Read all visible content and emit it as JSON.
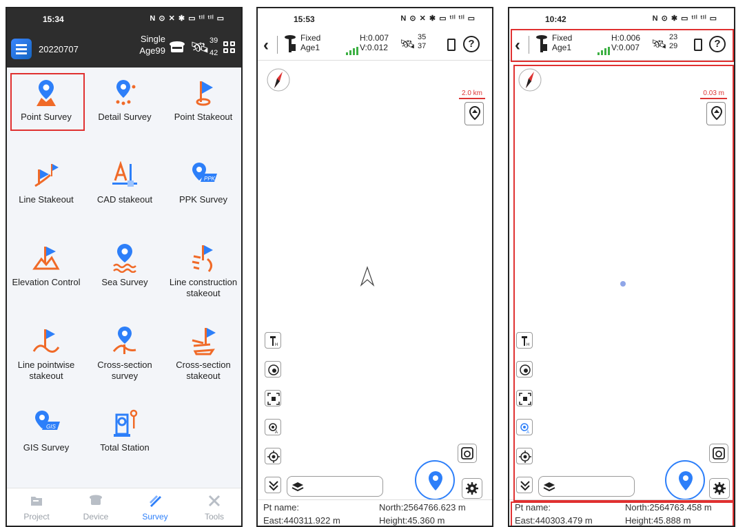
{
  "screen1": {
    "status": {
      "time": "15:34",
      "icons": "N ⊙ ✕ ✱ ▭ ᵗᴵˡ ᵗᴵˡ ▭"
    },
    "header": {
      "project": "20220707",
      "solution": "Single",
      "age": "Age99",
      "sat_top": "39",
      "sat_bottom": "42"
    },
    "menu": [
      {
        "label": "Point Survey",
        "icon": "point-survey-icon"
      },
      {
        "label": "Detail Survey",
        "icon": "detail-survey-icon"
      },
      {
        "label": "Point Stakeout",
        "icon": "point-stakeout-icon"
      },
      {
        "label": "Line Stakeout",
        "icon": "line-stakeout-icon"
      },
      {
        "label": "CAD stakeout",
        "icon": "cad-stakeout-icon"
      },
      {
        "label": "PPK Survey",
        "icon": "ppk-survey-icon"
      },
      {
        "label": "Elevation Control",
        "icon": "elevation-control-icon"
      },
      {
        "label": "Sea Survey",
        "icon": "sea-survey-icon"
      },
      {
        "label": "Line construction stakeout",
        "icon": "line-construction-stakeout-icon"
      },
      {
        "label": "Line pointwise stakeout",
        "icon": "line-pointwise-stakeout-icon"
      },
      {
        "label": "Cross-section survey",
        "icon": "cross-section-survey-icon"
      },
      {
        "label": "Cross-section stakeout",
        "icon": "cross-section-stakeout-icon"
      },
      {
        "label": "GIS Survey",
        "icon": "gis-survey-icon"
      },
      {
        "label": "Total Station",
        "icon": "total-station-icon"
      }
    ],
    "ppk_tag": "PPK",
    "gis_tag": "GIS",
    "tabs": [
      {
        "label": "Project",
        "active": false
      },
      {
        "label": "Device",
        "active": false
      },
      {
        "label": "Survey",
        "active": true
      },
      {
        "label": "Tools",
        "active": false
      }
    ]
  },
  "screen2": {
    "status": {
      "time": "15:53",
      "icons": "N ⊙ ✕ ✱ ▭ ᵗᴵˡ ᵗᴵˡ ▭"
    },
    "header": {
      "solution": "Fixed",
      "age": "Age1",
      "h": "H:0.007",
      "v": "V:0.012",
      "sat_top": "35",
      "sat_bottom": "37"
    },
    "scale": "2.0 km",
    "info": {
      "pt_name": "Pt name:",
      "north": "North:2564766.623 m",
      "east": "East:440311.922 m",
      "height": "Height:45.360 m"
    }
  },
  "screen3": {
    "status": {
      "time": "10:42",
      "icons": "N ⊙ ✱ ▭ ᵗᴵˡ ᵗᴵˡ ▭"
    },
    "header": {
      "solution": "Fixed",
      "age": "Age1",
      "h": "H:0.006",
      "v": "V:0.007",
      "sat_top": "23",
      "sat_bottom": "29"
    },
    "scale": "0.03 m",
    "info": {
      "pt_name": "Pt name:",
      "north": "North:2564763.458 m",
      "east": "East:440303.479 m",
      "height": "Height:45.888 m"
    }
  },
  "colors": {
    "accent": "#2d7ff9",
    "icon_orange": "#f06a28",
    "highlight": "#e03030",
    "header_dark": "#2d2d2d"
  }
}
